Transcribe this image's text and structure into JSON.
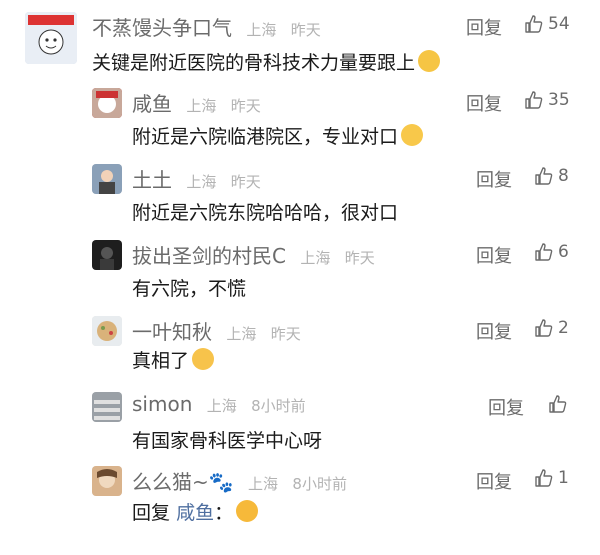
{
  "comments": [
    {
      "name": "不蒸馒头争口气",
      "location": "上海",
      "time": "昨天",
      "text": "关键是附近医院的骨科技术力量要跟上",
      "emoji": "grin",
      "reply_label": "回复",
      "likes": "54"
    },
    {
      "name": "咸鱼",
      "location": "上海",
      "time": "昨天",
      "text": "附近是六院临港院区，专业对口",
      "emoji": "smile",
      "reply_label": "回复",
      "likes": "35"
    },
    {
      "name": "土土",
      "location": "上海",
      "time": "昨天",
      "text": "附近是六院东院哈哈哈，很对口",
      "reply_label": "回复",
      "likes": "8"
    },
    {
      "name": "拔出圣剑的村民C",
      "location": "上海",
      "time": "昨天",
      "text": "有六院，不慌",
      "reply_label": "回复",
      "likes": "6"
    },
    {
      "name": "一叶知秋",
      "location": "上海",
      "time": "昨天",
      "text": "真相了",
      "emoji": "hush",
      "reply_label": "回复",
      "likes": "2"
    },
    {
      "name": "simon",
      "location": "上海",
      "time": "8小时前",
      "text": "有国家骨科医学中心呀",
      "reply_label": "回复",
      "likes": ""
    },
    {
      "name": "么么猫~🐾",
      "location": "上海",
      "time": "8小时前",
      "text_prefix": "回复",
      "reply_target": "咸鱼",
      "text_suffix": "：",
      "emoji": "cry",
      "reply_label": "回复",
      "likes": "1"
    }
  ],
  "colors": {
    "name": "#6b6b6b",
    "meta": "#b3b3b3",
    "text": "#1a1a1a",
    "link": "#4f6fa0"
  }
}
